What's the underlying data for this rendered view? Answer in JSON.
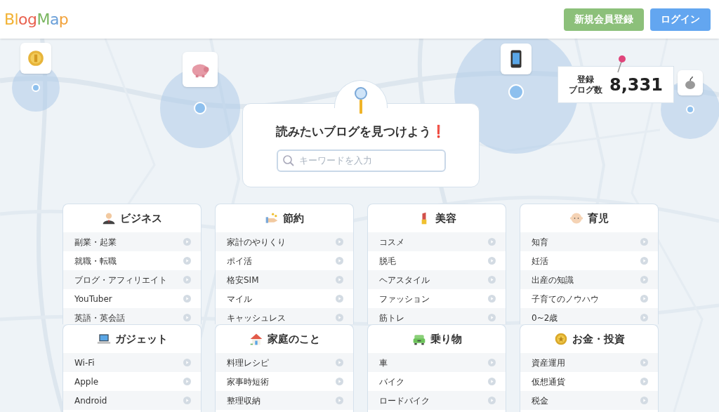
{
  "header": {
    "logo": "BlogMap",
    "buttons": [
      {
        "label": "新規会員登録",
        "kind": "signup"
      },
      {
        "label": "ログイン",
        "kind": "login"
      }
    ]
  },
  "hero": {
    "title": "読みたいブログを見つけよう",
    "title_mark": "❗",
    "search": {
      "placeholder": "キーワードを入力"
    },
    "counter": {
      "label_lines": [
        "登録",
        "ブログ数"
      ],
      "value": "8,331"
    }
  },
  "categories": [
    {
      "title": "ビジネス",
      "items": [
        "副業・起業",
        "就職・転職",
        "ブログ・アフィリエイト",
        "YouTuber",
        "英語・英会話"
      ]
    },
    {
      "title": "節約",
      "items": [
        "家計のやりくり",
        "ポイ活",
        "格安SIM",
        "マイル",
        "キャッシュレス"
      ]
    },
    {
      "title": "美容",
      "items": [
        "コスメ",
        "脱毛",
        "ヘアスタイル",
        "ファッション",
        "筋トレ"
      ]
    },
    {
      "title": "育児",
      "items": [
        "知育",
        "妊活",
        "出産の知識",
        "子育てのノウハウ",
        "0~2歳"
      ]
    },
    {
      "title": "ガジェット",
      "items": [
        "Wi-Fi",
        "Apple",
        "Android"
      ]
    },
    {
      "title": "家庭のこと",
      "items": [
        "料理レシピ",
        "家事時短術",
        "整理収納"
      ]
    },
    {
      "title": "乗り物",
      "items": [
        "車",
        "バイク",
        "ロードバイク"
      ]
    },
    {
      "title": "お金・投資",
      "items": [
        "資産運用",
        "仮想通貨",
        "税金"
      ]
    }
  ]
}
